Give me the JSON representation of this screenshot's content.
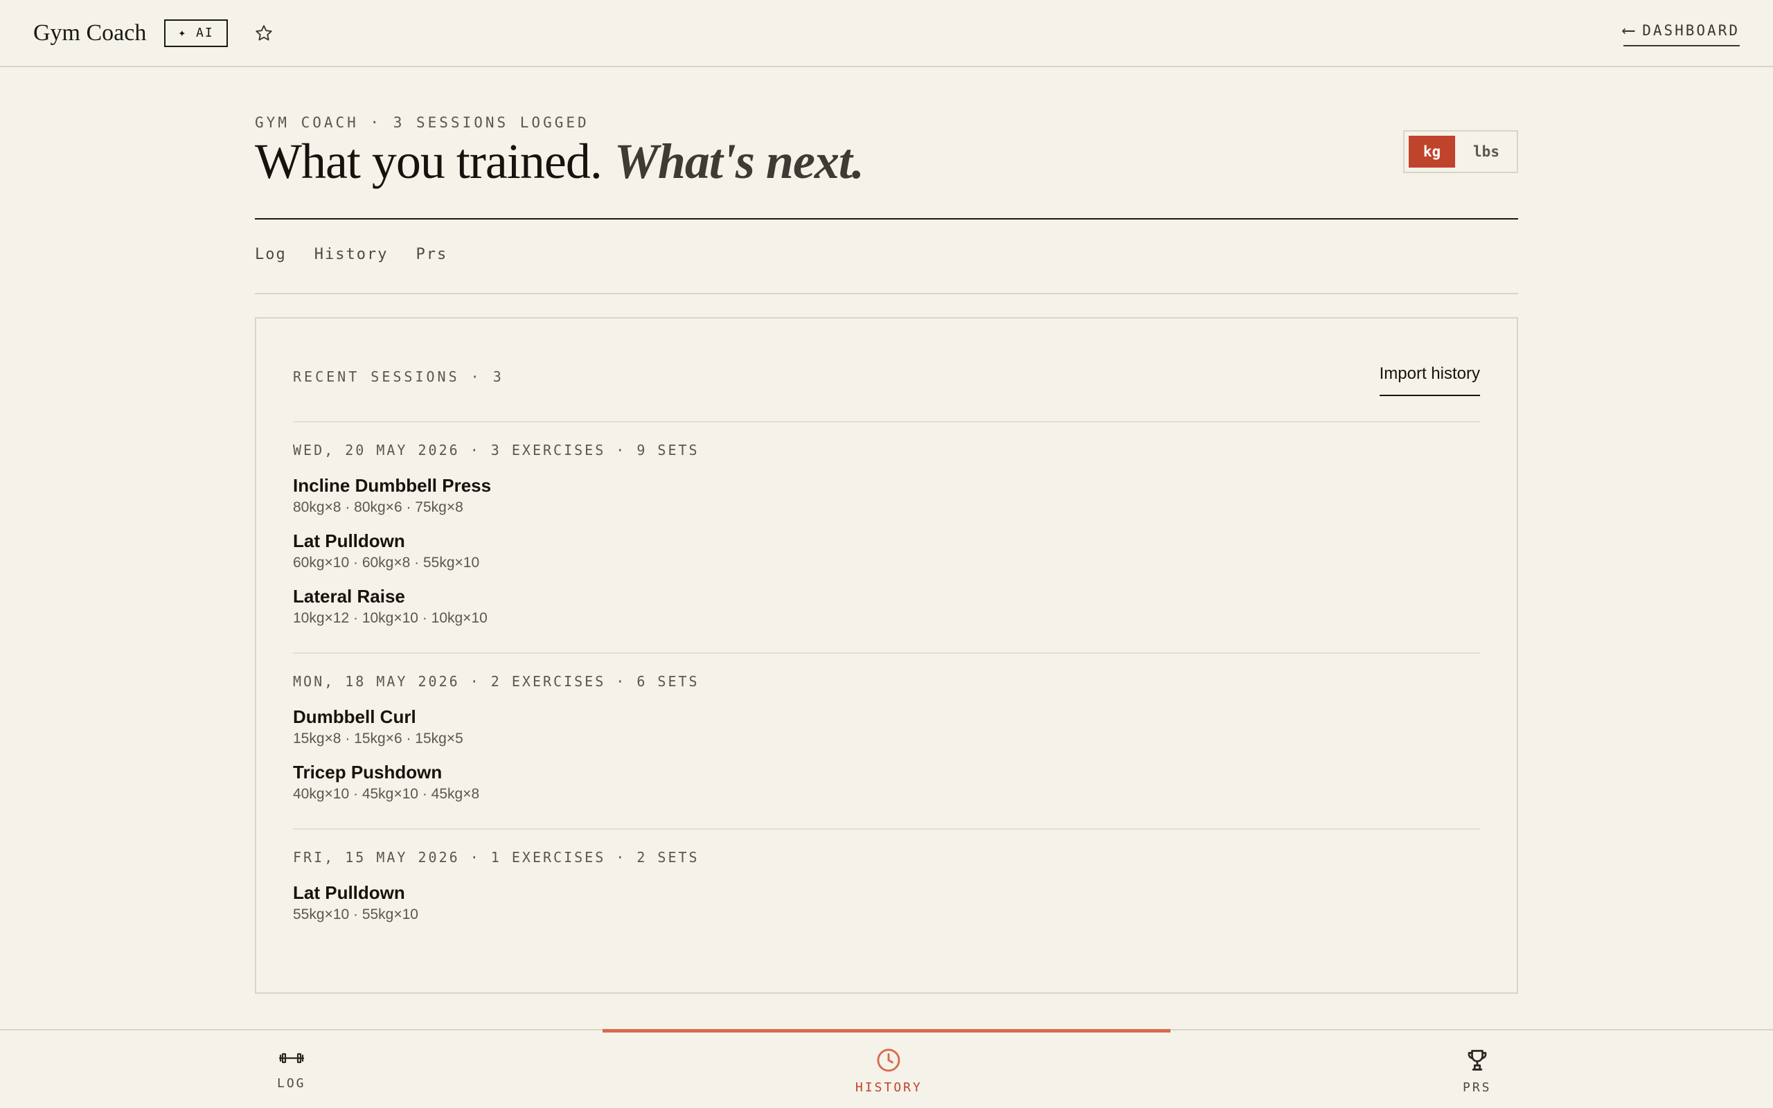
{
  "topbar": {
    "brand": "Gym Coach",
    "ai_badge": "✦ AI",
    "dashboard_label": "DASHBOARD",
    "dashboard_arrow": "⟵"
  },
  "header": {
    "eyebrow": "GYM COACH · 3 SESSIONS LOGGED",
    "title": "What you trained.",
    "title_italic": "What's next.",
    "units": [
      "kg",
      "lbs"
    ],
    "active_unit": "kg"
  },
  "tabs": [
    "Log",
    "History",
    "Prs"
  ],
  "card": {
    "title": "RECENT SESSIONS · 3",
    "import_label": "Import history",
    "sessions": [
      {
        "meta": "WED, 20 MAY 2026 · 3 EXERCISES · 9 SETS",
        "exercises": [
          {
            "name": "Incline Dumbbell Press",
            "sets": "80kg×8 · 80kg×6 · 75kg×8"
          },
          {
            "name": "Lat Pulldown",
            "sets": "60kg×10 · 60kg×8 · 55kg×10"
          },
          {
            "name": "Lateral Raise",
            "sets": "10kg×12 · 10kg×10 · 10kg×10"
          }
        ]
      },
      {
        "meta": "MON, 18 MAY 2026 · 2 EXERCISES · 6 SETS",
        "exercises": [
          {
            "name": "Dumbbell Curl",
            "sets": "15kg×8 · 15kg×6 · 15kg×5"
          },
          {
            "name": "Tricep Pushdown",
            "sets": "40kg×10 · 45kg×10 · 45kg×8"
          }
        ]
      },
      {
        "meta": "FRI, 15 MAY 2026 · 1 EXERCISES · 2 SETS",
        "exercises": [
          {
            "name": "Lat Pulldown",
            "sets": "55kg×10 · 55kg×10"
          }
        ]
      }
    ]
  },
  "bottomnav": {
    "items": [
      {
        "label": "LOG",
        "icon": "dumbbell-icon"
      },
      {
        "label": "HISTORY",
        "icon": "clock-icon"
      },
      {
        "label": "PRS",
        "icon": "trophy-icon"
      }
    ],
    "active": "HISTORY"
  },
  "colors": {
    "background": "#f5f2e9",
    "accent": "#c0432b",
    "indicator": "#d9694d",
    "text": "#1a1815",
    "muted": "#5b5650",
    "border": "#d9d4c6"
  }
}
